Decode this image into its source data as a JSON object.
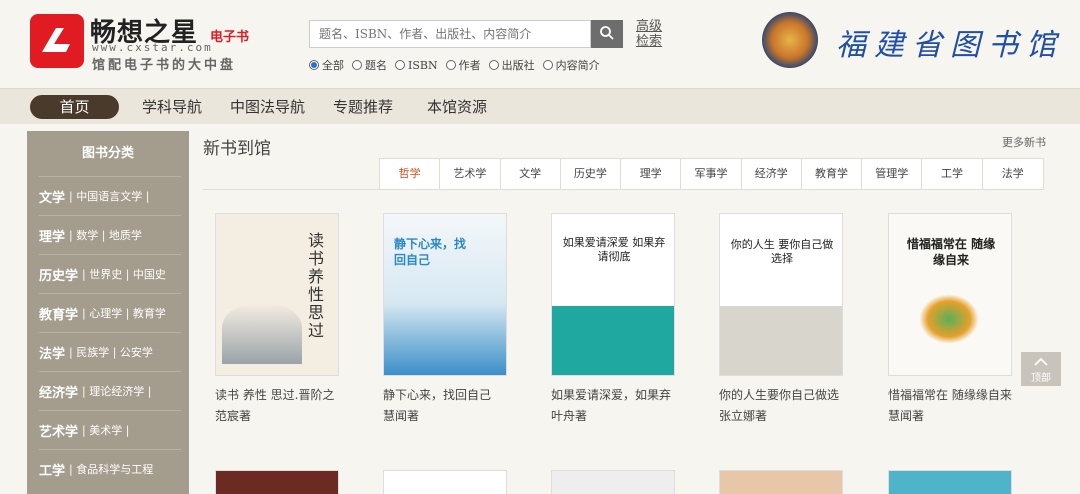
{
  "logo": {
    "title": "畅想之星",
    "ebook_badge": "电子书",
    "url": "www.cxstar.com",
    "slogan": "馆配电子书的大中盘"
  },
  "search": {
    "placeholder": "题名、ISBN、作者、出版社、内容简介",
    "advanced_label": "高级检索",
    "options": [
      {
        "label": "全部",
        "selected": true
      },
      {
        "label": "题名",
        "selected": false
      },
      {
        "label": "ISBN",
        "selected": false
      },
      {
        "label": "作者",
        "selected": false
      },
      {
        "label": "出版社",
        "selected": false
      },
      {
        "label": "内容简介",
        "selected": false
      }
    ]
  },
  "library": {
    "name": "福建省图书馆"
  },
  "nav": {
    "items": [
      "首页",
      "学科导航",
      "中图法导航",
      "专题推荐",
      "本馆资源"
    ],
    "active": "首页"
  },
  "sidebar": {
    "heading": "图书分类",
    "rows": [
      {
        "main": "文学",
        "subs": "中国语言文学 |"
      },
      {
        "main": "理学",
        "subs": "数学 | 地质学"
      },
      {
        "main": "历史学",
        "subs": "世界史 | 中国史"
      },
      {
        "main": "教育学",
        "subs": "心理学 | 教育学"
      },
      {
        "main": "法学",
        "subs": "民族学 | 公安学"
      },
      {
        "main": "经济学",
        "subs": "理论经济学 |"
      },
      {
        "main": "艺术学",
        "subs": "美术学 |"
      },
      {
        "main": "工学",
        "subs": "食品科学与工程"
      }
    ]
  },
  "content": {
    "title": "新书到馆",
    "more_label": "更多新书",
    "tabs": [
      "哲学",
      "艺术学",
      "文学",
      "历史学",
      "理学",
      "军事学",
      "经济学",
      "教育学",
      "管理学",
      "工学",
      "法学"
    ],
    "active_tab": "哲学",
    "books": [
      {
        "title": "读书 养性 思过.晋阶之",
        "author": "范宸著",
        "cover_text": "读书 养性 思过"
      },
      {
        "title": "静下心来，找回自己",
        "author": "慧闻著",
        "cover_text": "静下心来，找回自己"
      },
      {
        "title": "如果爱请深爱，如果弃",
        "author": "叶舟著",
        "cover_text": "如果爱请深爱 如果弃请彻底"
      },
      {
        "title": "你的人生要你自己做选",
        "author": "张立娜著",
        "cover_text": "你的人生 要你自己做选择"
      },
      {
        "title": "惜福福常在 随缘缘自来",
        "author": "慧闻著",
        "cover_text": "惜福福常在 随缘缘自来"
      }
    ]
  },
  "back_to_top": "顶部",
  "colors": {
    "brand_red": "#e01b22",
    "nav_active": "#4a3a2c",
    "sidebar_bg": "#a49c8d",
    "tab_active": "#d04d1a",
    "library_blue": "#1f4fa6"
  }
}
